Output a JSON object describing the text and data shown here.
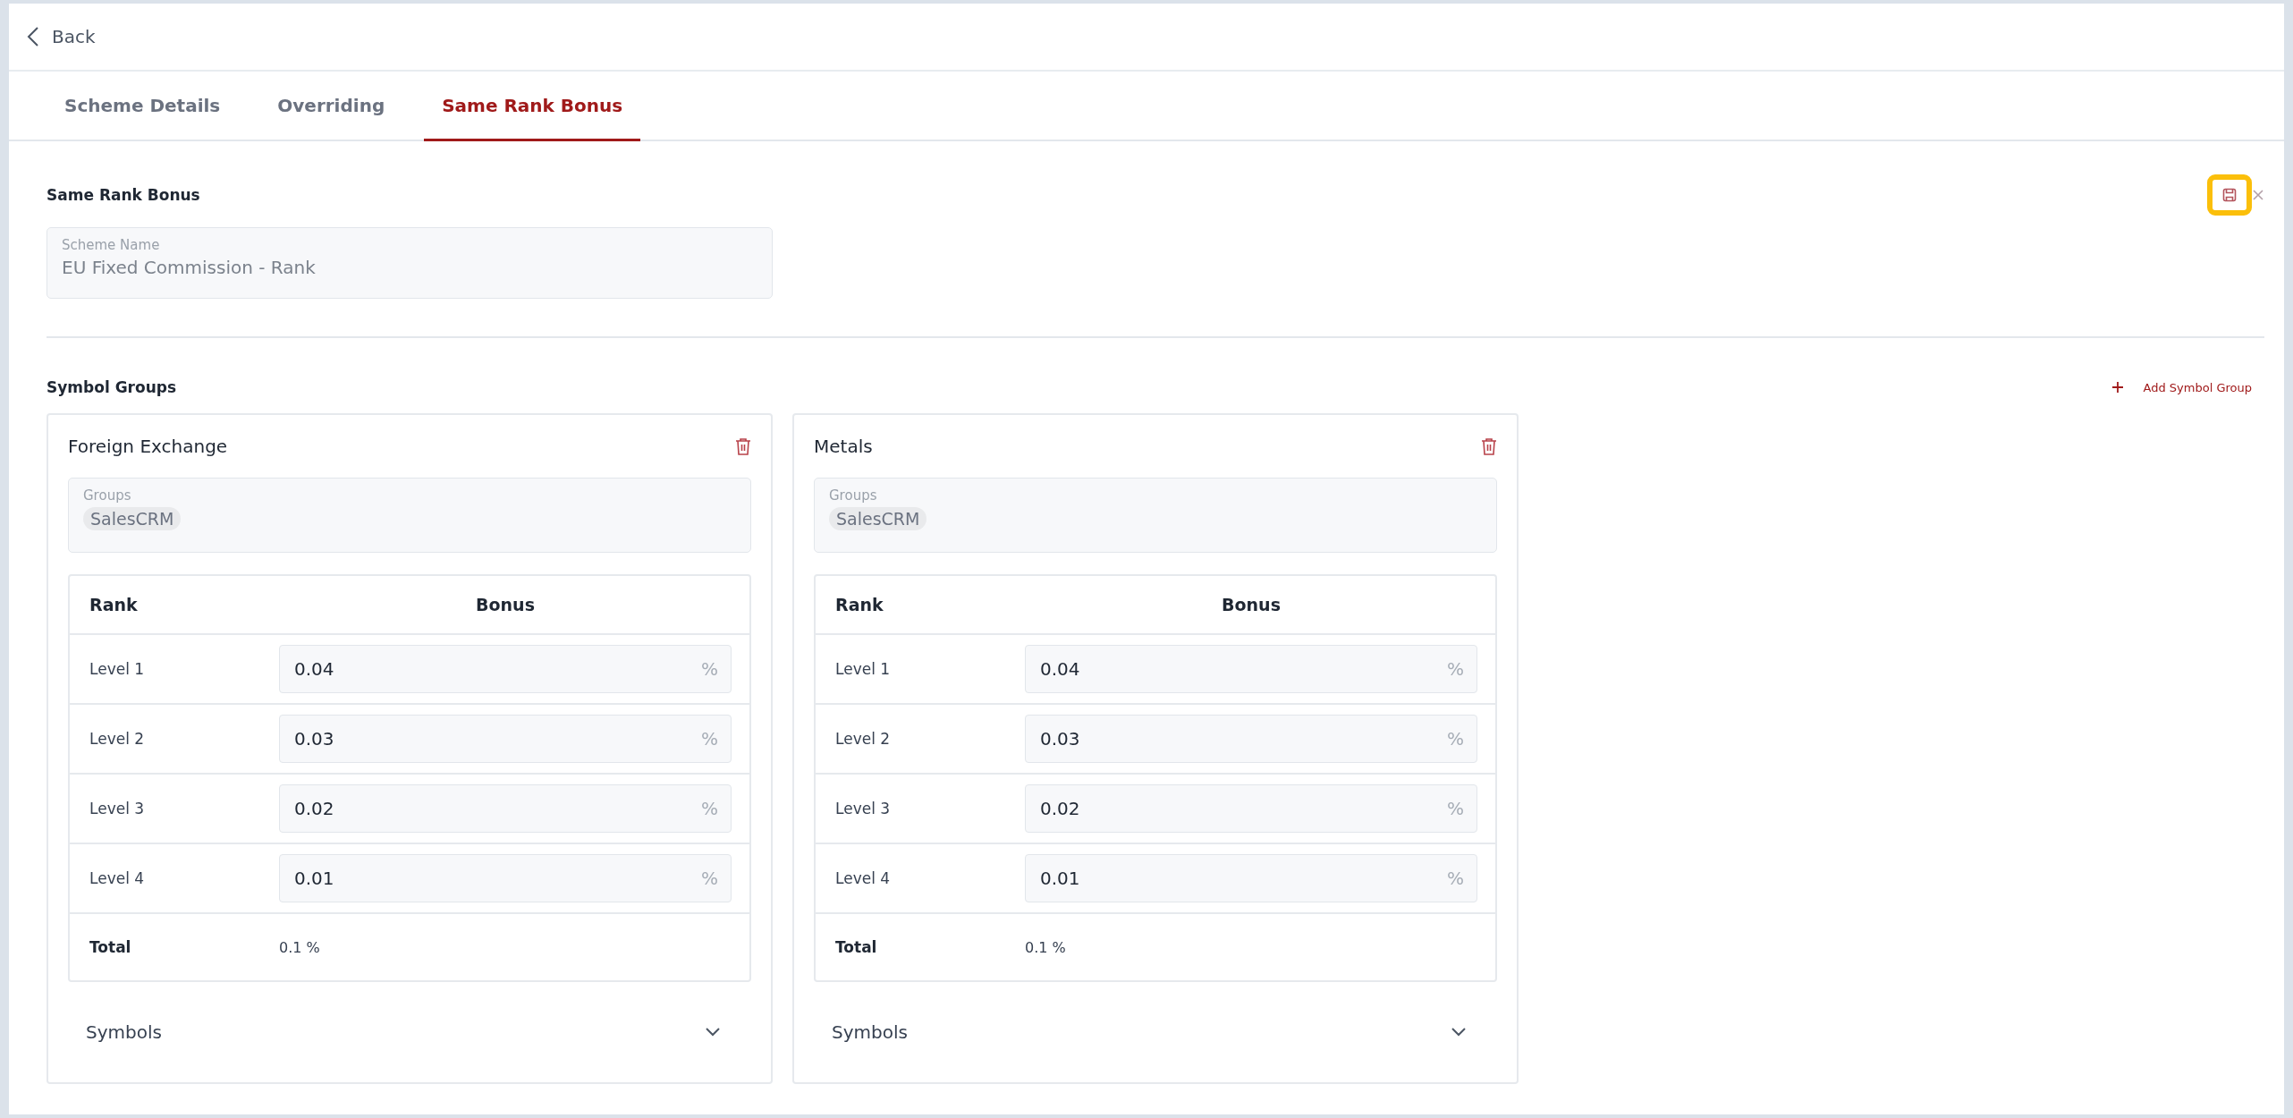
{
  "back": "Back",
  "tabs": [
    {
      "label": "Scheme Details",
      "selected": false
    },
    {
      "label": "Overriding",
      "selected": false
    },
    {
      "label": "Same Rank Bonus",
      "selected": true
    }
  ],
  "section": {
    "title": "Same Rank Bonus",
    "save_highlighted": true
  },
  "scheme_field": {
    "label": "Scheme Name",
    "value": "EU Fixed Commission - Rank"
  },
  "symbol_groups": {
    "title": "Symbol Groups",
    "add_label": "Add Symbol Group",
    "cards": [
      {
        "title": "Foreign Exchange",
        "groups_label": "Groups",
        "groups": [
          "SalesCRM"
        ],
        "columns": [
          "Rank",
          "Bonus"
        ],
        "rows": [
          {
            "rank": "Level 1",
            "value": "0.04",
            "unit": "%"
          },
          {
            "rank": "Level 2",
            "value": "0.03",
            "unit": "%"
          },
          {
            "rank": "Level 3",
            "value": "0.02",
            "unit": "%"
          },
          {
            "rank": "Level 4",
            "value": "0.01",
            "unit": "%"
          }
        ],
        "total": {
          "label": "Total",
          "value": "0.1 %"
        },
        "symbols_label": "Symbols",
        "expanded": false
      },
      {
        "title": "Metals",
        "groups_label": "Groups",
        "groups": [
          "SalesCRM"
        ],
        "columns": [
          "Rank",
          "Bonus"
        ],
        "rows": [
          {
            "rank": "Level 1",
            "value": "0.04",
            "unit": "%"
          },
          {
            "rank": "Level 2",
            "value": "0.03",
            "unit": "%"
          },
          {
            "rank": "Level 3",
            "value": "0.02",
            "unit": "%"
          },
          {
            "rank": "Level 4",
            "value": "0.01",
            "unit": "%"
          }
        ],
        "total": {
          "label": "Total",
          "value": "0.1 %"
        },
        "symbols_label": "Symbols",
        "expanded": false
      }
    ]
  }
}
